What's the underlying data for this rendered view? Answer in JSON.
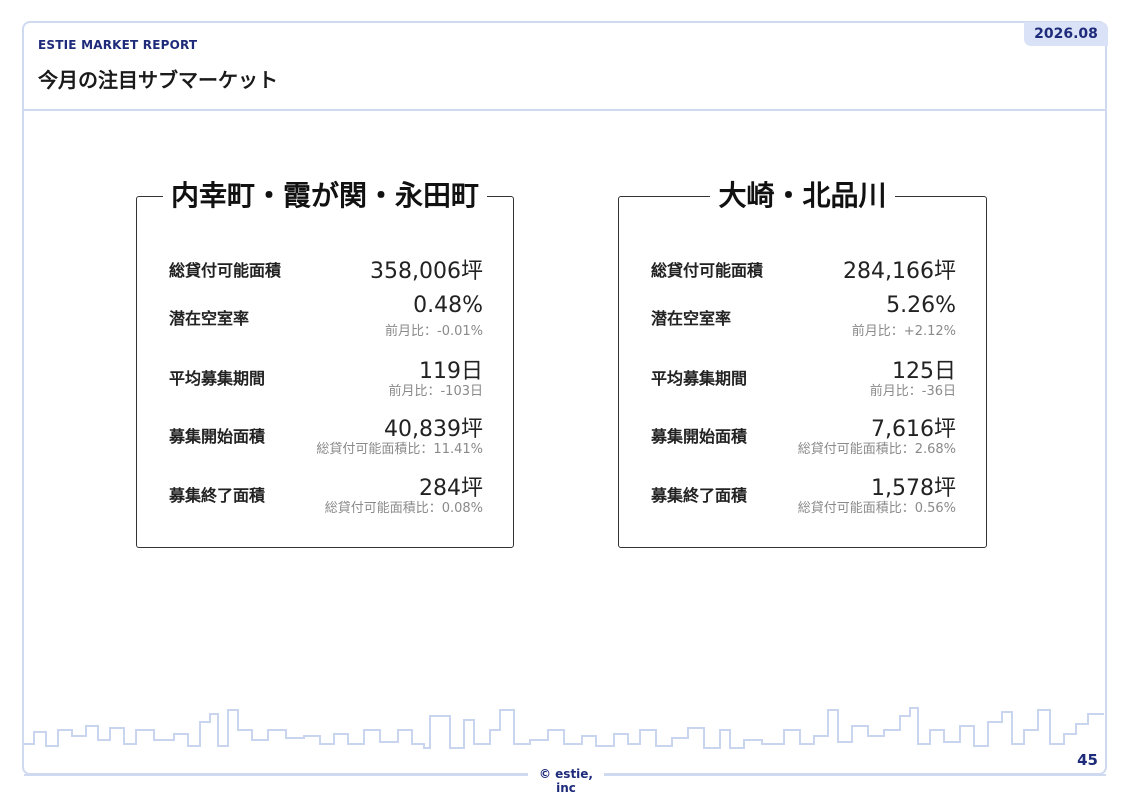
{
  "header": {
    "report_label": "ESTIE MARKET REPORT",
    "title": "今月の注目サブマーケット",
    "date": "2026.08"
  },
  "cards": [
    {
      "title": "内幸町・霞が関・永田町",
      "rows": [
        {
          "label": "総貸付可能面積",
          "value": "358,006坪",
          "sub": ""
        },
        {
          "label": "潜在空室率",
          "value": "0.48%",
          "sub": "前月比：-0.01%"
        },
        {
          "label": "平均募集期間",
          "value": "119日",
          "sub": "前月比：-103日"
        },
        {
          "label": "募集開始面積",
          "value": "40,839坪",
          "sub": "総貸付可能面積比：11.41%"
        },
        {
          "label": "募集終了面積",
          "value": "284坪",
          "sub": "総貸付可能面積比：0.08%"
        }
      ]
    },
    {
      "title": "大崎・北品川",
      "rows": [
        {
          "label": "総貸付可能面積",
          "value": "284,166坪",
          "sub": ""
        },
        {
          "label": "潜在空室率",
          "value": "5.26%",
          "sub": "前月比：+2.12%"
        },
        {
          "label": "平均募集期間",
          "value": "125日",
          "sub": "前月比：-36日"
        },
        {
          "label": "募集開始面積",
          "value": "7,616坪",
          "sub": "総貸付可能面積比：2.68%"
        },
        {
          "label": "募集終了面積",
          "value": "1,578坪",
          "sub": "総貸付可能面積比：0.56%"
        }
      ]
    }
  ],
  "footer": {
    "copyright": "© estie, inc",
    "page_number": "45"
  },
  "colors": {
    "brand": "#1e2b7a",
    "border": "#cfd9f0",
    "badge_bg": "#d9e2f6",
    "skyline": "#c9d4ee"
  }
}
